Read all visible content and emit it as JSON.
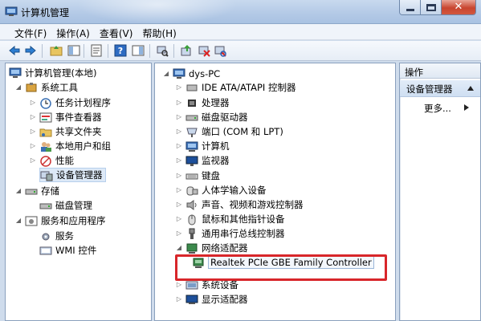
{
  "window": {
    "title": "计算机管理"
  },
  "menu": [
    "文件(F)",
    "操作(A)",
    "查看(V)",
    "帮助(H)"
  ],
  "left_tree": {
    "root": "计算机管理(本地)",
    "groups": [
      {
        "label": "系统工具",
        "items": [
          "任务计划程序",
          "事件查看器",
          "共享文件夹",
          "本地用户和组",
          "性能",
          "设备管理器"
        ]
      },
      {
        "label": "存储",
        "items": [
          "磁盘管理"
        ]
      },
      {
        "label": "服务和应用程序",
        "items": [
          "服务",
          "WMI 控件"
        ]
      }
    ]
  },
  "device_tree": {
    "computer": "dys-PC",
    "categories": [
      "IDE ATA/ATAPI 控制器",
      "处理器",
      "磁盘驱动器",
      "端口 (COM 和 LPT)",
      "计算机",
      "监视器",
      "键盘",
      "人体学输入设备",
      "声音、视频和游戏控制器",
      "鼠标和其他指针设备",
      "通用串行总线控制器",
      "网络适配器"
    ],
    "selected_device": "Realtek PCIe GBE Family Controller",
    "after": [
      "系统设备",
      "显示适配器"
    ]
  },
  "actions": {
    "header": "操作",
    "section": "设备管理器",
    "more": "更多..."
  },
  "colors": {
    "highlight_box": "#d8262a",
    "selection": "#dde9f7"
  }
}
